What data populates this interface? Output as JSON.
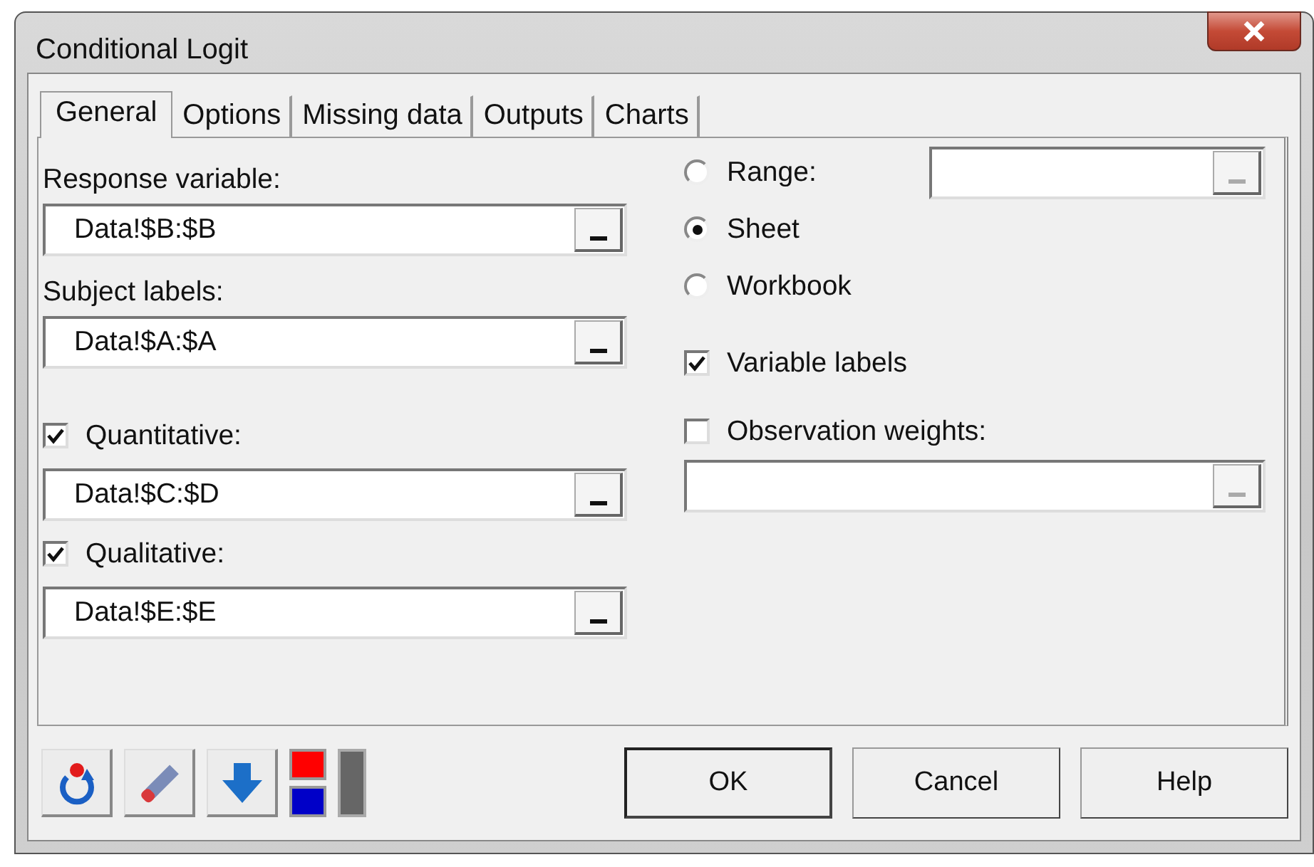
{
  "window": {
    "title": "Conditional Logit"
  },
  "tabs": [
    {
      "label": "General",
      "selected": true
    },
    {
      "label": "Options",
      "selected": false
    },
    {
      "label": "Missing data",
      "selected": false
    },
    {
      "label": "Outputs",
      "selected": false
    },
    {
      "label": "Charts",
      "selected": false
    }
  ],
  "left_inputs": [
    {
      "kind": "label",
      "label": "Response variable:",
      "value": "Data!$B:$B"
    },
    {
      "kind": "label",
      "label": "Subject labels:",
      "value": "Data!$A:$A"
    },
    {
      "kind": "checkbox",
      "label": "Quantitative:",
      "checked": true,
      "value": "Data!$C:$D"
    },
    {
      "kind": "checkbox",
      "label": "Qualitative:",
      "checked": true,
      "value": "Data!$E:$E"
    }
  ],
  "range_options": [
    {
      "label": "Range:",
      "selected": false
    },
    {
      "label": "Sheet",
      "selected": true
    },
    {
      "label": "Workbook",
      "selected": false
    }
  ],
  "variable_labels": {
    "label": "Variable labels",
    "checked": true
  },
  "observation_weights": {
    "label": "Observation weights:",
    "checked": false
  },
  "buttons": [
    {
      "label": "OK",
      "default": true
    },
    {
      "label": "Cancel",
      "default": false
    },
    {
      "label": "Help",
      "default": false
    }
  ]
}
